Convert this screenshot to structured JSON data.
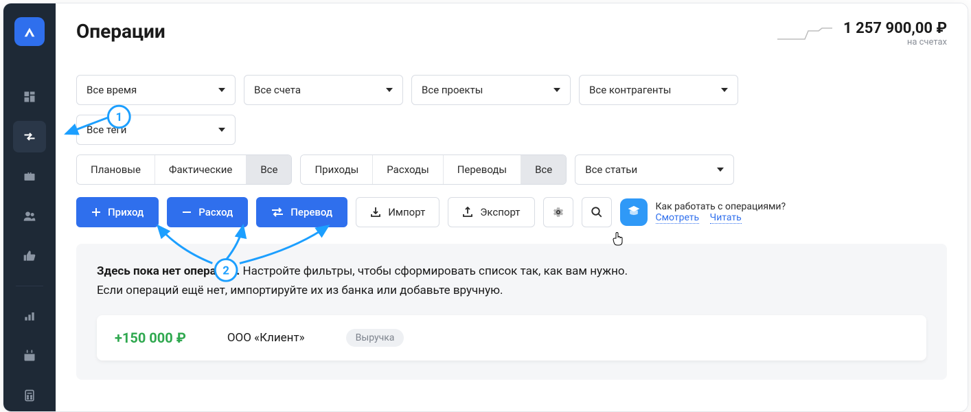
{
  "header": {
    "title": "Операции",
    "balance_amount": "1 257 900,00 ₽",
    "balance_caption": "на счетах"
  },
  "filters": {
    "time": "Все время",
    "accounts": "Все счета",
    "projects": "Все проекты",
    "contractors": "Все контрагенты",
    "tags": "Все теги"
  },
  "segment_status": {
    "planned": "Плановые",
    "actual": "Фактические",
    "all": "Все"
  },
  "segment_type": {
    "income": "Приходы",
    "expense": "Расходы",
    "transfer": "Переводы",
    "all": "Все"
  },
  "articles_filter": "Все статьи",
  "actions": {
    "income": "Приход",
    "expense": "Расход",
    "transfer": "Перевод",
    "import": "Импорт",
    "export": "Экспорт"
  },
  "help": {
    "title": "Как работать с операциями?",
    "watch": "Смотреть",
    "read": "Читать"
  },
  "empty": {
    "bold": "Здесь пока нет операций.",
    "rest": " Настройте фильтры, чтобы сформировать список так, как вам нужно.",
    "line2": "Если операций ещё нет, импортируйте их из банка или добавьте вручную."
  },
  "sample": {
    "amount": "+150 000 ₽",
    "client": "ООО «Клиент»",
    "tag": "Выручка"
  },
  "annotations": {
    "marker1": "1",
    "marker2": "2"
  }
}
